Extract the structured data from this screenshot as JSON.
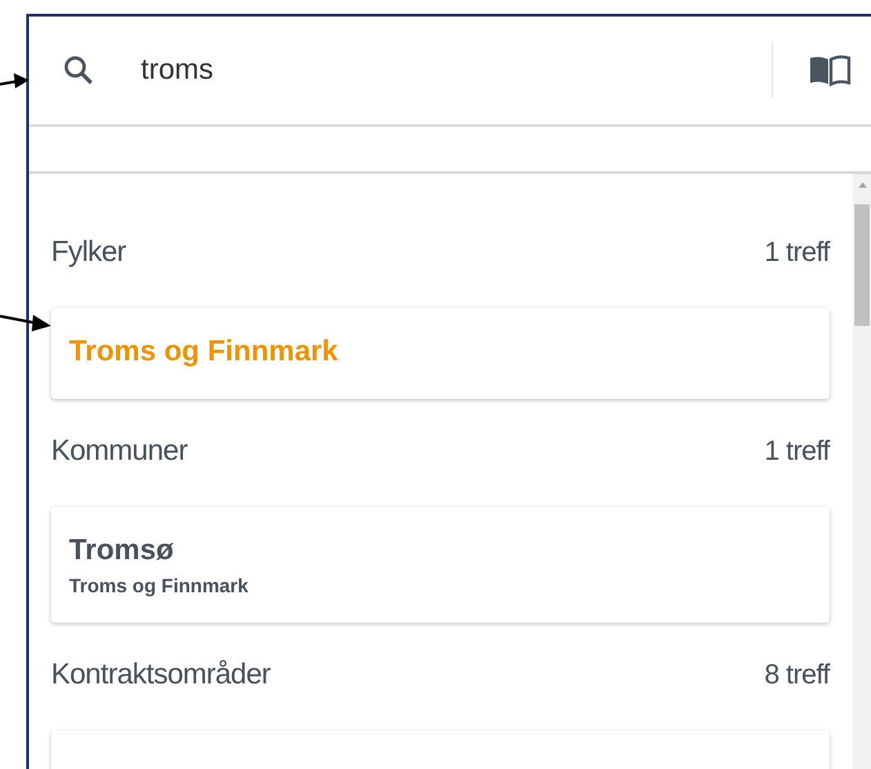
{
  "search": {
    "value": "troms"
  },
  "sections": [
    {
      "title": "Fylker",
      "count": "1 treff",
      "items": [
        {
          "title": "Troms og Finnmark",
          "selected": true
        }
      ]
    },
    {
      "title": "Kommuner",
      "count": "1 treff",
      "items": [
        {
          "title": "Tromsø",
          "subtitle": "Troms og Finnmark",
          "selected": false
        }
      ]
    },
    {
      "title": "Kontraktsområder",
      "count": "8 treff",
      "cut_off": true
    }
  ]
}
